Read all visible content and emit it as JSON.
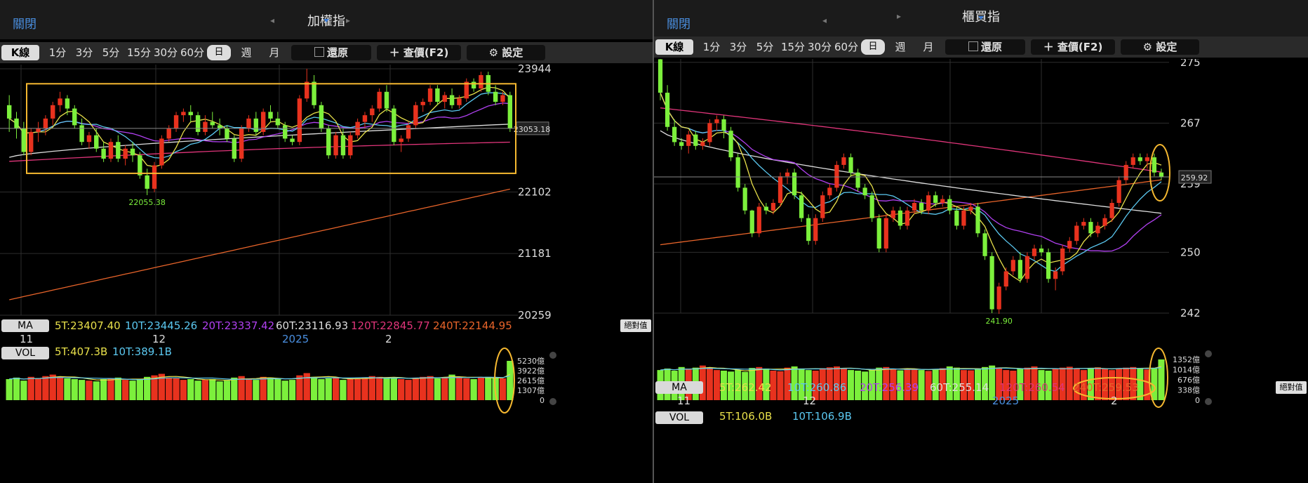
{
  "panels": [
    {
      "id": "taiex",
      "title": "加權指",
      "close": "關閉",
      "toolbar": {
        "k": "K線",
        "m1": "1分",
        "m3": "3分",
        "m5": "5分",
        "m15": "15分",
        "m30": "30分",
        "m60": "60分",
        "day": "日",
        "week": "週",
        "month": "月",
        "restore": "還原",
        "lookup": "＋ 查價(F2)",
        "settings": "設定"
      },
      "ma": {
        "label": "MA",
        "t5": "5T:23407.40",
        "t10": "10T:23445.26",
        "t20": "20T:23337.42",
        "t60": "60T:23116.93",
        "t120": "120T:22845.77",
        "t240": "240T:22144.95",
        "abs": "絕對值"
      },
      "dates": {
        "d11": "11",
        "d12": "12",
        "y2025": "2025",
        "d2": "2"
      },
      "vol": {
        "label": "VOL",
        "t5": "5T:407.3B",
        "t10": "10T:389.1B",
        "ticks": [
          "5230億",
          "3922億",
          "2615億",
          "1307億",
          "0"
        ]
      },
      "colors": {
        "up": "#e8321e",
        "down": "#7cf03c",
        "ma5": "#e8e04a",
        "ma10": "#5bc8f0",
        "ma20": "#b040f0",
        "ma60": "#dddddd",
        "ma120": "#e0357a",
        "ma240": "#e8642a",
        "highlight": "#f5b830"
      }
    },
    {
      "id": "otc",
      "title": "櫃買指",
      "close": "關閉",
      "toolbar": {
        "k": "K線",
        "m1": "1分",
        "m3": "3分",
        "m5": "5分",
        "m15": "15分",
        "m30": "30分",
        "m60": "60分",
        "day": "日",
        "week": "週",
        "month": "月",
        "restore": "還原",
        "lookup": "＋ 查價(F2)",
        "settings": "設定"
      },
      "ma": {
        "label": "MA",
        "t5": "5T:262.42",
        "t10": "10T:260.86",
        "t20": "20T:256.39",
        "t60": "60T:255.14",
        "t120": "120T:260.54",
        "t240": "240T:259.53",
        "abs": "絕對值"
      },
      "dates": {
        "d11": "11",
        "d12": "12",
        "y2025": "2025",
        "d2": "2"
      },
      "vol": {
        "label": "VOL",
        "t5": "5T:106.0B",
        "t10": "10T:106.9B",
        "ticks": [
          "1352億",
          "1014億",
          "676億",
          "338億",
          "0"
        ]
      },
      "colors": {
        "up": "#e8321e",
        "down": "#7cf03c",
        "ma5": "#e8e04a",
        "ma10": "#5bc8f0",
        "ma20": "#b040f0",
        "ma60": "#dddddd",
        "ma120": "#e0357a",
        "ma240": "#e8642a",
        "highlight": "#f5b830"
      }
    }
  ],
  "chart_data": [
    {
      "type": "candlestick",
      "title": "加權指",
      "ylim": [
        20259,
        23944
      ],
      "yticks": [
        "23944",
        "22102",
        "21181",
        "20259"
      ],
      "x_labels": [
        "11",
        "12",
        "2025",
        "2"
      ],
      "last_price": "23053.18",
      "high_label": "23943.95",
      "low_label": "22055.38",
      "high": 23943.95,
      "low": 22055.38,
      "last": 23053.18,
      "candles": [
        [
          23400,
          23550,
          23000,
          23200
        ],
        [
          23200,
          23300,
          22900,
          23050
        ],
        [
          23050,
          23150,
          22650,
          22700
        ],
        [
          22700,
          23050,
          22650,
          23000
        ],
        [
          23000,
          23150,
          22850,
          23050
        ],
        [
          23050,
          23250,
          22950,
          23200
        ],
        [
          23200,
          23450,
          23100,
          23400
        ],
        [
          23400,
          23600,
          23300,
          23500
        ],
        [
          23500,
          23550,
          23250,
          23350
        ],
        [
          23350,
          23400,
          23050,
          23100
        ],
        [
          23100,
          23200,
          22800,
          22850
        ],
        [
          22850,
          23000,
          22750,
          22950
        ],
        [
          22950,
          23050,
          22700,
          22750
        ],
        [
          22750,
          22850,
          22550,
          22600
        ],
        [
          22600,
          22900,
          22550,
          22850
        ],
        [
          22850,
          22950,
          22550,
          22600
        ],
        [
          22600,
          22800,
          22500,
          22750
        ],
        [
          22750,
          22850,
          22550,
          22650
        ],
        [
          22650,
          22700,
          22300,
          22350
        ],
        [
          22350,
          22450,
          22055,
          22150
        ],
        [
          22150,
          22550,
          22100,
          22500
        ],
        [
          22500,
          22950,
          22450,
          22900
        ],
        [
          22900,
          23100,
          22850,
          23050
        ],
        [
          23050,
          23300,
          23000,
          23250
        ],
        [
          23250,
          23350,
          23150,
          23300
        ],
        [
          23300,
          23400,
          23150,
          23250
        ],
        [
          23250,
          23300,
          22950,
          23000
        ],
        [
          23000,
          23250,
          22950,
          23150
        ],
        [
          23150,
          23300,
          23050,
          23100
        ],
        [
          23100,
          23200,
          22950,
          23050
        ],
        [
          23050,
          23100,
          22850,
          22900
        ],
        [
          22900,
          22950,
          22550,
          22600
        ],
        [
          22600,
          23100,
          22550,
          23050
        ],
        [
          23050,
          23250,
          23000,
          23200
        ],
        [
          23200,
          23300,
          22950,
          23000
        ],
        [
          23000,
          23350,
          22950,
          23300
        ],
        [
          23300,
          23400,
          23150,
          23200
        ],
        [
          23200,
          23300,
          23050,
          23100
        ],
        [
          23100,
          23150,
          22850,
          22900
        ],
        [
          22900,
          22950,
          22800,
          22850
        ],
        [
          22850,
          23550,
          22800,
          23500
        ],
        [
          23500,
          23944,
          23450,
          23750
        ],
        [
          23750,
          23850,
          23350,
          23400
        ],
        [
          23400,
          23450,
          23000,
          23050
        ],
        [
          23050,
          23100,
          22600,
          22650
        ],
        [
          22650,
          23000,
          22600,
          22950
        ],
        [
          22950,
          23050,
          22600,
          22650
        ],
        [
          22650,
          23000,
          22600,
          22950
        ],
        [
          22950,
          23200,
          22900,
          23150
        ],
        [
          23150,
          23300,
          23050,
          23250
        ],
        [
          23250,
          23400,
          23150,
          23350
        ],
        [
          23350,
          23650,
          23300,
          23600
        ],
        [
          23600,
          23700,
          23300,
          23350
        ],
        [
          23350,
          23400,
          22800,
          22850
        ],
        [
          22850,
          22950,
          22700,
          22900
        ],
        [
          22900,
          23150,
          22850,
          23100
        ],
        [
          23100,
          23450,
          23050,
          23400
        ],
        [
          23400,
          23500,
          23300,
          23450
        ],
        [
          23450,
          23700,
          23400,
          23650
        ],
        [
          23650,
          23700,
          23400,
          23450
        ],
        [
          23450,
          23600,
          23350,
          23550
        ],
        [
          23550,
          23650,
          23350,
          23400
        ],
        [
          23400,
          23550,
          23350,
          23500
        ],
        [
          23500,
          23800,
          23450,
          23750
        ],
        [
          23750,
          23800,
          23600,
          23650
        ],
        [
          23650,
          23900,
          23600,
          23850
        ],
        [
          23850,
          23900,
          23550,
          23600
        ],
        [
          23600,
          23700,
          23400,
          23450
        ],
        [
          23450,
          23600,
          23400,
          23550
        ],
        [
          23550,
          23600,
          23000,
          23053
        ]
      ],
      "volume": [
        2800,
        3000,
        2600,
        3100,
        2900,
        3200,
        3400,
        3100,
        2900,
        2800,
        2700,
        2600,
        2500,
        2800,
        2900,
        3000,
        2700,
        2600,
        2800,
        3100,
        3300,
        3500,
        3000,
        2900,
        2700,
        2800,
        2600,
        2700,
        2800,
        2500,
        2600,
        3000,
        3200,
        2900,
        2700,
        3100,
        3000,
        2800,
        2600,
        2700,
        3300,
        3600,
        3100,
        2800,
        2900,
        3000,
        2700,
        2800,
        2900,
        3000,
        3200,
        3100,
        2900,
        3000,
        2800,
        2700,
        3000,
        3100,
        3200,
        2900,
        3000,
        3400,
        3100,
        2900,
        2800,
        3000,
        3100,
        3000,
        2900,
        5230
      ],
      "ma": {
        "5T": 23407.4,
        "10T": 23445.26,
        "20T": 23337.42,
        "60T": 23116.93,
        "120T": 22845.77,
        "240T": 22144.95
      },
      "annotations": [
        "range box",
        "volume highlight"
      ]
    },
    {
      "type": "candlestick",
      "title": "櫃買指",
      "ylim": [
        242,
        275.44
      ],
      "yticks": [
        "275",
        "267",
        "259",
        "250",
        "242"
      ],
      "x_labels": [
        "11",
        "12",
        "2025",
        "2"
      ],
      "last_price": "259.92",
      "high_label": "275.44",
      "low_label": "241.90",
      "high": 275.44,
      "low": 241.9,
      "last": 259.92,
      "candles": [
        [
          275.4,
          275.44,
          270,
          271
        ],
        [
          271,
          272,
          266,
          266.5
        ],
        [
          266.5,
          267.5,
          264,
          264.5
        ],
        [
          264.5,
          265,
          263.5,
          264
        ],
        [
          264,
          266,
          263,
          265.5
        ],
        [
          265.5,
          266,
          263.5,
          264
        ],
        [
          264,
          265,
          263.5,
          264.5
        ],
        [
          264.5,
          267.5,
          264,
          267
        ],
        [
          267,
          268,
          266,
          267.5
        ],
        [
          267.5,
          268,
          265,
          266
        ],
        [
          266,
          266.5,
          262,
          262.5
        ],
        [
          262.5,
          263,
          258,
          258.5
        ],
        [
          258.5,
          259,
          255,
          255.5
        ],
        [
          255.5,
          255.6,
          252,
          252.5
        ],
        [
          252.5,
          256.5,
          252,
          256
        ],
        [
          256,
          256.5,
          255,
          255.5
        ],
        [
          255.5,
          257,
          255,
          256.5
        ],
        [
          256.5,
          260.5,
          256,
          260
        ],
        [
          260,
          261,
          259,
          260.5
        ],
        [
          260.5,
          261,
          257,
          257.5
        ],
        [
          257.5,
          258,
          254,
          254.5
        ],
        [
          254.5,
          255,
          251,
          251.5
        ],
        [
          251.5,
          255,
          251,
          254.5
        ],
        [
          254.5,
          258,
          254,
          257.5
        ],
        [
          257.5,
          259,
          257,
          258.5
        ],
        [
          258.5,
          262,
          258,
          261.5
        ],
        [
          261.5,
          263,
          261,
          262.5
        ],
        [
          262.5,
          263,
          260,
          260.5
        ],
        [
          260.5,
          261,
          258,
          258.5
        ],
        [
          258.5,
          259,
          257,
          257.5
        ],
        [
          257.5,
          258,
          254,
          254.5
        ],
        [
          254.5,
          255,
          250,
          250.5
        ],
        [
          250.5,
          255,
          250,
          254.5
        ],
        [
          254.5,
          256,
          254,
          255.5
        ],
        [
          255.5,
          256,
          253,
          253.5
        ],
        [
          253.5,
          256,
          253,
          255.5
        ],
        [
          255.5,
          257,
          255,
          256.5
        ],
        [
          256.5,
          257,
          255,
          255.5
        ],
        [
          255.5,
          258,
          255,
          257.5
        ],
        [
          257.5,
          258,
          256,
          256.5
        ],
        [
          256.5,
          257.5,
          256,
          257
        ],
        [
          257,
          257.5,
          255,
          255.5
        ],
        [
          255.5,
          256,
          253,
          253.5
        ],
        [
          253.5,
          256,
          253,
          255.5
        ],
        [
          255.5,
          256.5,
          255,
          256
        ],
        [
          256,
          256.5,
          252,
          252.5
        ],
        [
          252.5,
          253,
          249,
          249.5
        ],
        [
          249.5,
          250,
          242,
          242.5
        ],
        [
          242.5,
          246,
          241.9,
          245.5
        ],
        [
          245.5,
          248,
          245,
          247.5
        ],
        [
          247.5,
          249.5,
          247,
          249
        ],
        [
          249,
          250,
          246,
          246.5
        ],
        [
          246.5,
          250,
          246,
          249.5
        ],
        [
          249.5,
          251,
          249,
          250.5
        ],
        [
          250.5,
          251,
          249.5,
          250
        ],
        [
          250,
          250.5,
          246,
          246.5
        ],
        [
          246.5,
          248,
          245,
          247.5
        ],
        [
          247.5,
          251,
          247,
          250.5
        ],
        [
          250.5,
          252,
          250,
          251.5
        ],
        [
          251.5,
          254,
          251,
          253.5
        ],
        [
          253.5,
          254.5,
          253,
          254
        ],
        [
          254,
          254.5,
          252,
          252.5
        ],
        [
          252.5,
          254,
          252,
          253.5
        ],
        [
          253.5,
          255,
          253,
          254.5
        ],
        [
          254.5,
          257,
          254,
          256.5
        ],
        [
          256.5,
          260,
          256,
          259.5
        ],
        [
          259.5,
          262,
          259,
          261.5
        ],
        [
          261.5,
          263,
          261,
          262.5
        ],
        [
          262.5,
          263,
          261.5,
          262
        ],
        [
          262,
          263,
          261,
          262.5
        ],
        [
          262.5,
          263,
          260,
          260.5
        ],
        [
          260.5,
          261,
          259.5,
          259.92
        ]
      ],
      "volume": [
        1000,
        1050,
        980,
        1100,
        1020,
        1080,
        1150,
        1090,
        1000,
        980,
        950,
        1000,
        940,
        1070,
        1100,
        1050,
        980,
        960,
        1080,
        1120,
        1050,
        1000,
        980,
        1060,
        1090,
        1120,
        1050,
        1000,
        980,
        950,
        1000,
        1080,
        1100,
        1020,
        990,
        1060,
        1050,
        1000,
        970,
        1010,
        1060,
        1120,
        1080,
        1000,
        990,
        1040,
        1100,
        1150,
        1080,
        1000,
        980,
        1050,
        1080,
        1120,
        1000,
        980,
        1040,
        1080,
        1110,
        1050,
        1000,
        1060,
        1090,
        1040,
        1000,
        1050,
        1080,
        1100,
        1060,
        1020,
        1050,
        1352
      ],
      "ma": {
        "5T": 262.42,
        "10T": 260.86,
        "20T": 256.39,
        "60T": 255.14,
        "120T": 260.54,
        "240T": 259.53
      },
      "annotations": [
        "ma240 highlight",
        "last candle highlight",
        "volume highlight"
      ]
    }
  ]
}
